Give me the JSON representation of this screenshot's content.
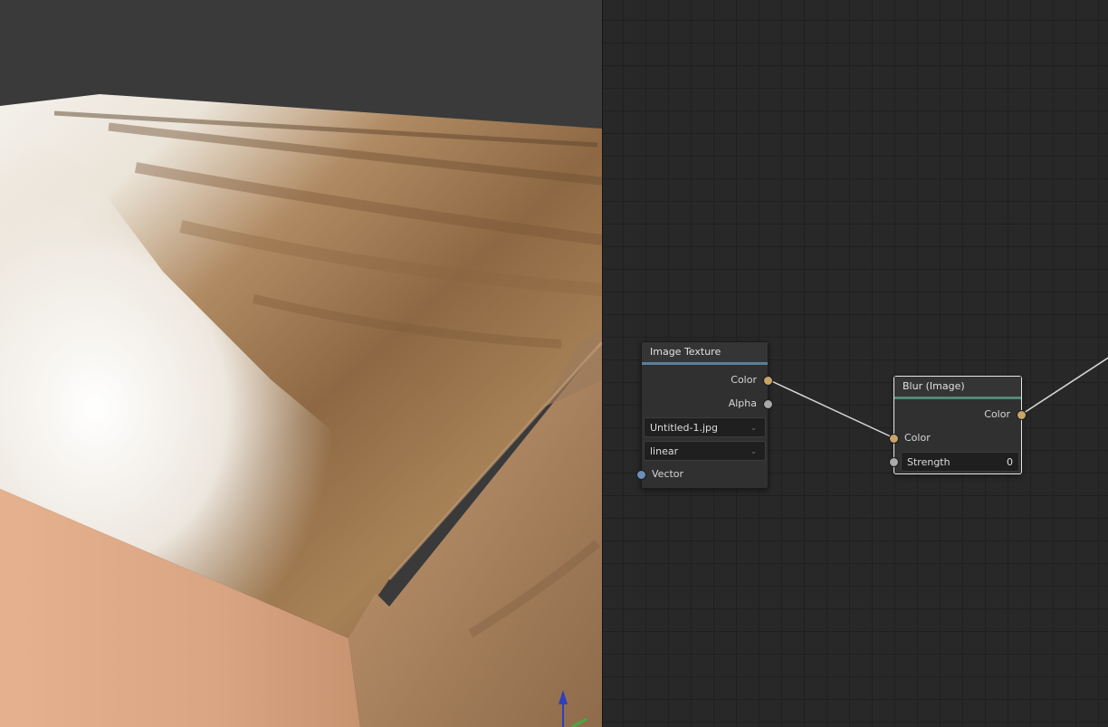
{
  "viewport": {
    "gizmo_axis": "z-axis"
  },
  "node_editor": {
    "image_texture": {
      "title": "Image Texture",
      "outputs": [
        "Color",
        "Alpha"
      ],
      "image_name": "Untitled-1.jpg",
      "interpolation": "linear",
      "inputs": [
        "Vector"
      ]
    },
    "blur": {
      "title": "Blur (Image)",
      "output": "Color",
      "input_color": "Color",
      "strength_label": "Strength",
      "strength_value": "0"
    },
    "colors": {
      "color_socket": "#c9a469",
      "float_socket": "#a9a9a9",
      "vector_socket": "#6b8fb8",
      "texture_header_accent": "#5a7f9a",
      "converter_header_accent": "#4f8a76"
    }
  }
}
